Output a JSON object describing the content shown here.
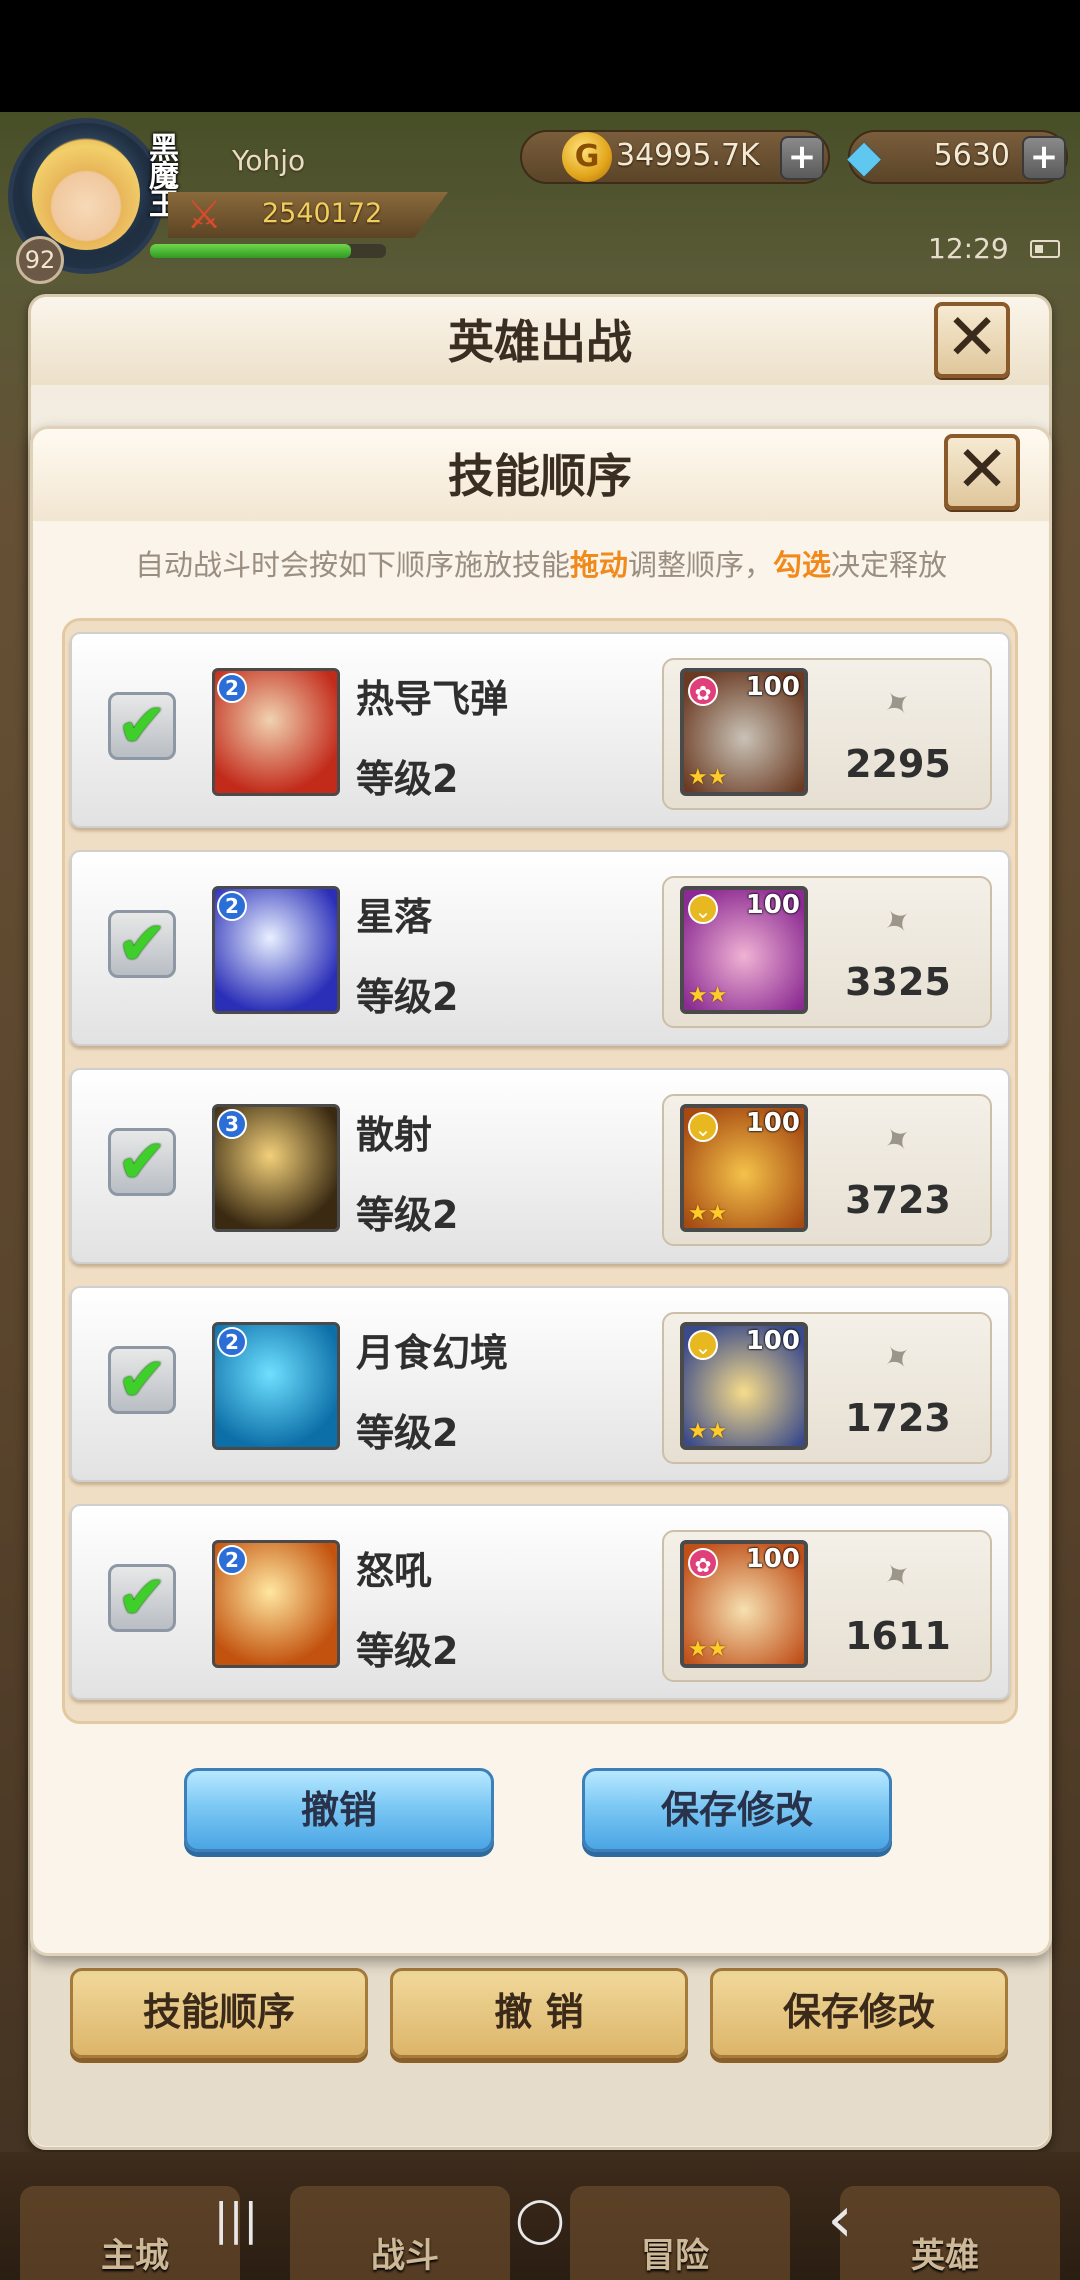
{
  "player": {
    "name": "Yohjo",
    "level": "92",
    "vip_tag": "黑魔王",
    "power": "2540172",
    "hp_fraction": 0.85
  },
  "resources": {
    "gold": "34995.7K",
    "gold_symbol": "G",
    "gems": "5630",
    "plus": "+"
  },
  "status": {
    "time": "12:29"
  },
  "outer_panel": {
    "title": "英雄出战",
    "close": "✕",
    "buttons": {
      "skill_order": "技能顺序",
      "undo": "撤 销",
      "save": "保存修改"
    }
  },
  "skill_dialog": {
    "title": "技能顺序",
    "close": "✕",
    "hint_1": "自动战斗时会按如下顺序施放技能",
    "hint_drag": "拖动",
    "hint_2": "调整顺序，",
    "hint_check": "勾选",
    "hint_3": "决定释放",
    "check": "✔",
    "skills": [
      {
        "name": "热导飞弹",
        "level_text": "等级2",
        "badge": "2",
        "hero_level": "100",
        "hero_rank": "pink",
        "power": "2295",
        "icon": "missile-icon",
        "colors": [
          "#f0d2b0",
          "#c22a1a"
        ]
      },
      {
        "name": "星落",
        "level_text": "等级2",
        "badge": "2",
        "hero_level": "100",
        "hero_rank": "gold",
        "power": "3325",
        "icon": "starfall-icon",
        "colors": [
          "#e8f0ff",
          "#2b2fb8"
        ]
      },
      {
        "name": "散射",
        "level_text": "等级2",
        "badge": "3",
        "hero_level": "100",
        "hero_rank": "gold",
        "power": "3723",
        "icon": "scatter-icon",
        "colors": [
          "#f2d07a",
          "#3a2a12"
        ]
      },
      {
        "name": "月食幻境",
        "level_text": "等级2",
        "badge": "2",
        "hero_level": "100",
        "hero_rank": "gold",
        "power": "1723",
        "icon": "moon-icon",
        "colors": [
          "#6ee0ff",
          "#0d6fa8"
        ]
      },
      {
        "name": "怒吼",
        "level_text": "等级2",
        "badge": "2",
        "hero_level": "100",
        "hero_rank": "pink",
        "power": "1611",
        "icon": "roar-icon",
        "colors": [
          "#ffe7a0",
          "#c2520e"
        ]
      }
    ],
    "buttons": {
      "undo": "撤销",
      "save": "保存修改"
    }
  },
  "nav": {
    "tabs": [
      "主城",
      "战斗",
      "冒险",
      "英雄"
    ],
    "sys": {
      "recent": "|||",
      "home": "◯",
      "back": "‹"
    }
  },
  "colors": {
    "accent_orange": "#f08a1c",
    "check_green": "#3fcf2a",
    "button_blue": "#7cc8f4",
    "rank_pink": "#e0407a",
    "rank_gold": "#e8b820"
  }
}
